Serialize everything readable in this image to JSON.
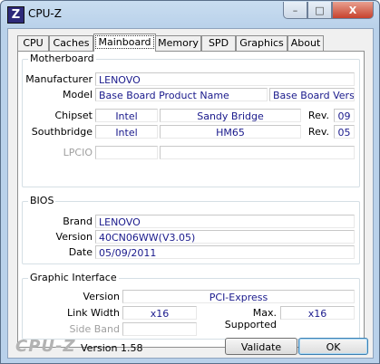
{
  "window": {
    "title": "CPU-Z",
    "icon_letter": "Z"
  },
  "caption_buttons": {
    "minimize": "–",
    "maximize": "□",
    "close": "X"
  },
  "tabs": [
    {
      "label": "CPU"
    },
    {
      "label": "Caches"
    },
    {
      "label": "Mainboard",
      "active": true
    },
    {
      "label": "Memory"
    },
    {
      "label": "SPD"
    },
    {
      "label": "Graphics"
    },
    {
      "label": "About"
    }
  ],
  "motherboard": {
    "title": "Motherboard",
    "manufacturer_label": "Manufacturer",
    "manufacturer": "LENOVO",
    "model_label": "Model",
    "model": "Base Board Product Name",
    "model_version": "Base Board Version",
    "chipset_label": "Chipset",
    "chipset_vendor": "Intel",
    "chipset_name": "Sandy Bridge",
    "chipset_rev_label": "Rev.",
    "chipset_rev": "09",
    "southbridge_label": "Southbridge",
    "southbridge_vendor": "Intel",
    "southbridge_name": "HM65",
    "southbridge_rev_label": "Rev.",
    "southbridge_rev": "05",
    "lpcio_label": "LPCIO",
    "lpcio_vendor": "",
    "lpcio_name": ""
  },
  "bios": {
    "title": "BIOS",
    "brand_label": "Brand",
    "brand": "LENOVO",
    "version_label": "Version",
    "version": "40CN06WW(V3.05)",
    "date_label": "Date",
    "date": "05/09/2011"
  },
  "graphic_interface": {
    "title": "Graphic Interface",
    "version_label": "Version",
    "version": "PCI-Express",
    "link_width_label": "Link Width",
    "link_width": "x16",
    "max_supported_label": "Max. Supported",
    "max_supported": "x16",
    "side_band_label": "Side Band",
    "side_band": ""
  },
  "footer": {
    "logo": "CPU-Z",
    "version_text": "Version 1.58",
    "validate_label": "Validate",
    "ok_label": "OK"
  }
}
